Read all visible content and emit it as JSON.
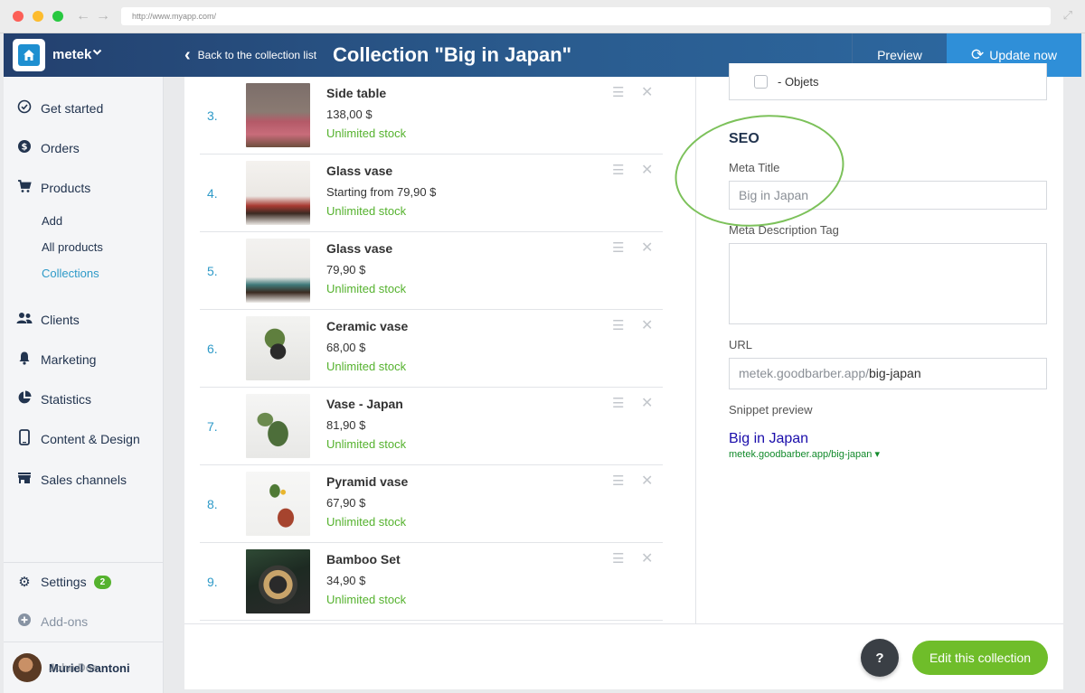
{
  "browser": {
    "url": "http://www.myapp.com/"
  },
  "header": {
    "account_name": "metek",
    "back_label": "Back to the collection list",
    "page_title": "Collection \"Big in Japan\"",
    "preview_label": "Preview",
    "update_label": "Update now"
  },
  "sidebar": {
    "items": [
      {
        "label": "Get started",
        "icon": "check-circle-icon"
      },
      {
        "label": "Orders",
        "icon": "dollar-circle-icon"
      },
      {
        "label": "Products",
        "icon": "cart-icon"
      },
      {
        "label": "Clients",
        "icon": "people-icon"
      },
      {
        "label": "Marketing",
        "icon": "bell-icon"
      },
      {
        "label": "Statistics",
        "icon": "pie-chart-icon"
      },
      {
        "label": "Content & Design",
        "icon": "phone-icon"
      },
      {
        "label": "Sales channels",
        "icon": "store-icon"
      }
    ],
    "product_subitems": [
      "Add",
      "All products",
      "Collections"
    ],
    "active_subitem": "Collections",
    "settings_label": "Settings",
    "settings_badge": "2",
    "addons_label": "Add-ons",
    "user_name": "Muriel Santoni",
    "user_name_overlap": "John Doe"
  },
  "products": [
    {
      "num": "3.",
      "name": "Side table",
      "price": "138,00 $",
      "stock": "Unlimited stock"
    },
    {
      "num": "4.",
      "name": "Glass vase",
      "price": "Starting from 79,90 $",
      "stock": "Unlimited stock"
    },
    {
      "num": "5.",
      "name": "Glass vase",
      "price": "79,90 $",
      "stock": "Unlimited stock"
    },
    {
      "num": "6.",
      "name": "Ceramic vase",
      "price": "68,00 $",
      "stock": "Unlimited stock"
    },
    {
      "num": "7.",
      "name": "Vase - Japan",
      "price": "81,90 $",
      "stock": "Unlimited stock"
    },
    {
      "num": "8.",
      "name": "Pyramid vase",
      "price": "67,90 $",
      "stock": "Unlimited stock"
    },
    {
      "num": "9.",
      "name": "Bamboo Set",
      "price": "34,90 $",
      "stock": "Unlimited stock"
    }
  ],
  "seo": {
    "checkbox_label": "- Objets",
    "section_title": "SEO",
    "meta_title_label": "Meta Title",
    "meta_title_value": "Big in Japan",
    "meta_desc_label": "Meta Description Tag",
    "meta_desc_value": "",
    "url_label": "URL",
    "url_prefix": "metek.goodbarber.app/",
    "url_slug": "big-japan",
    "snippet_label": "Snippet preview",
    "snippet_title": "Big in Japan",
    "snippet_url": "metek.goodbarber.app/big-japan ▾"
  },
  "footer": {
    "help_icon": "chat-help-icon",
    "help_text": "?",
    "edit_label": "Edit this collection"
  },
  "colors": {
    "accent_blue": "#2e9ac8",
    "stock_green": "#55b22e",
    "button_green": "#6fbd2a",
    "header_dark": "#23406e"
  }
}
